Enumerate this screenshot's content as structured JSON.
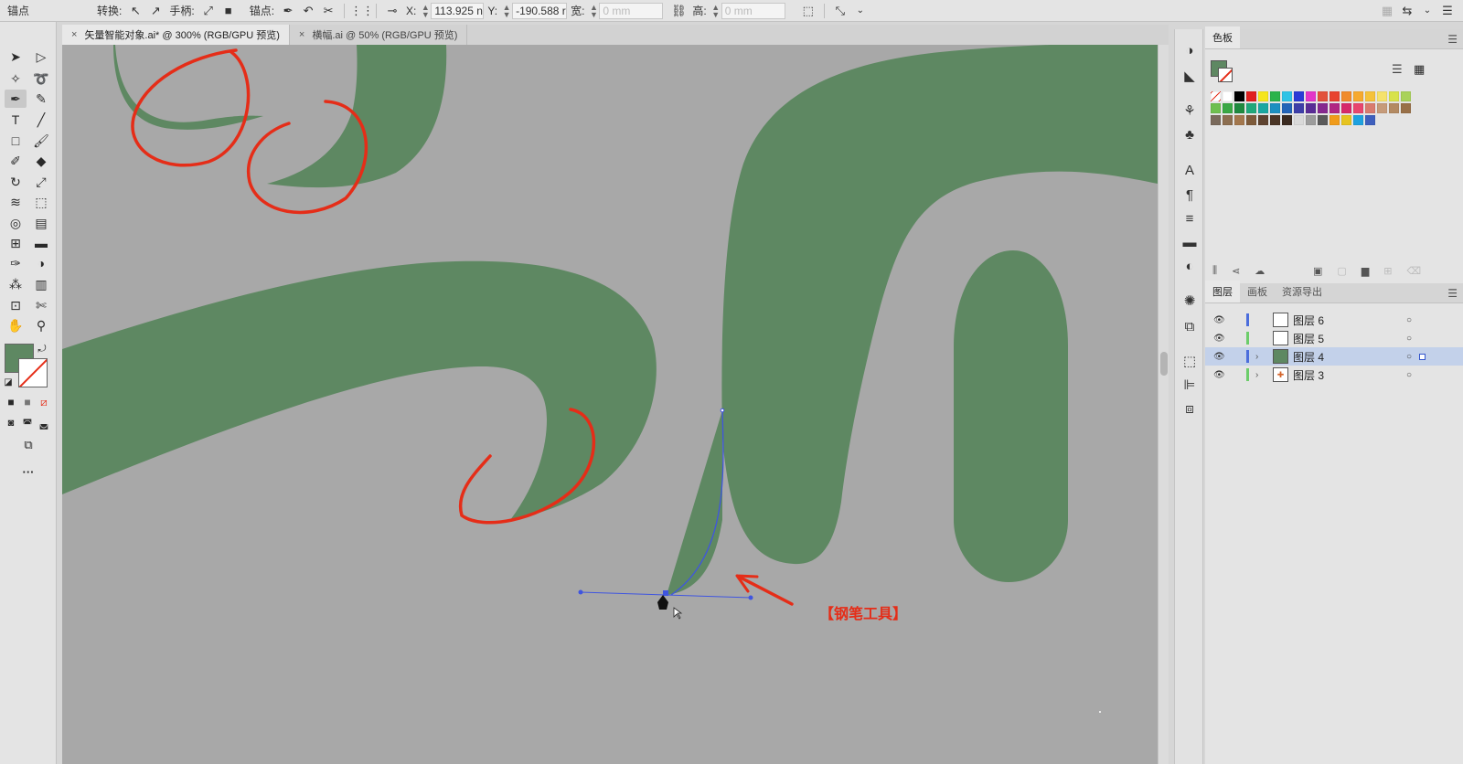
{
  "control_bar": {
    "mode_label": "锚点",
    "convert_label": "转换:",
    "handles_label": "手柄:",
    "anchors_label": "锚点:",
    "x_label": "X:",
    "x_value": "113.925 n",
    "y_label": "Y:",
    "y_value": "-190.588 r",
    "width_label": "宽:",
    "width_value": "0 mm",
    "height_label": "高:",
    "height_value": "0 mm"
  },
  "tabs": [
    {
      "label": "矢量智能对象.ai* @ 300% (RGB/GPU 预览)",
      "close": "×",
      "active": true
    },
    {
      "label": "横幅.ai @ 50% (RGB/GPU 预览)",
      "close": "×",
      "active": false
    }
  ],
  "toolbar": {
    "more_label": "···"
  },
  "annotation": {
    "pen_tool_label": "【钢笔工具】"
  },
  "colors": {
    "shape_fill": "#5e8862",
    "canvas_bg": "#a8a8a8",
    "annotation_red": "#e52d18",
    "path_blue": "#3f55e0"
  },
  "swatches_panel": {
    "tab_label": "色板"
  },
  "layers_panel": {
    "tabs": [
      "图层",
      "画板",
      "资源导出"
    ],
    "layers": [
      {
        "name": "图层 6",
        "color": "#4b6ddc",
        "expandable": false,
        "selected": false
      },
      {
        "name": "图层 5",
        "color": "#6ccd6a",
        "expandable": false,
        "selected": false
      },
      {
        "name": "图层 4",
        "color": "#4b6ddc",
        "expandable": true,
        "selected": true
      },
      {
        "name": "图层 3",
        "color": "#6ccd6a",
        "expandable": true,
        "selected": false
      }
    ]
  }
}
